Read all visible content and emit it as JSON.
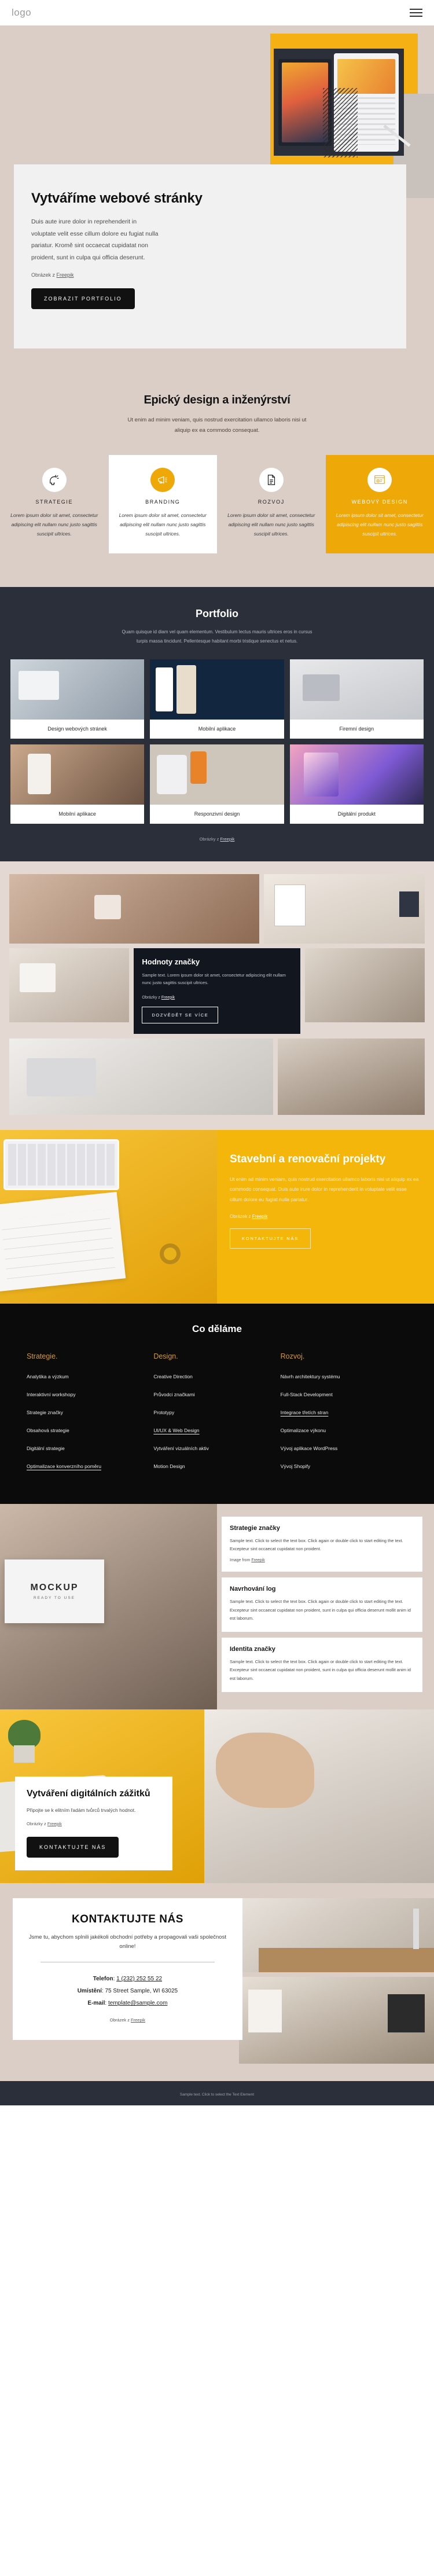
{
  "header": {
    "logo": "logo",
    "menu_icon": "hamburger-icon"
  },
  "hero": {
    "title": "Vytváříme webové stránky",
    "body": "Duis aute irure dolor in reprehenderit in voluptate velit esse cillum dolore eu fugiat nulla pariatur. Kromě sint occaecat cupidatat non proident, sunt in culpa qui officia deserunt.",
    "credit_prefix": "Obrázek z ",
    "credit_link": "Freepik",
    "cta": "ZOBRAZIT PORTFOLIO"
  },
  "services": {
    "title": "Epický design a inženýrství",
    "subtitle": "Ut enim ad minim veniam, quis nostrud exercitation ullamco laboris nisi ut aliquip ex ea commodo consequat.",
    "items": [
      {
        "icon": "head-idea-icon",
        "title": "STRATEGIE",
        "text": "Lorem ipsum dolor sit amet, consectetur adipiscing elit nullam nunc justo sagittis suscipit ultrices.",
        "style": "plain"
      },
      {
        "icon": "megaphone-icon",
        "title": "BRANDING",
        "text": "Lorem ipsum dolor sit amet, consectetur adipiscing elit nullam nunc justo sagittis suscipit ultrices.",
        "style": "white"
      },
      {
        "icon": "document-icon",
        "title": "ROZVOJ",
        "text": "Lorem ipsum dolor sit amet, consectetur adipiscing elit nullam nunc justo sagittis suscipit ultrices.",
        "style": "plain"
      },
      {
        "icon": "browser-design-icon",
        "title": "WEBOVÝ DESIGN",
        "text": "Lorem ipsum dolor sit amet, consectetur adipiscing elit nullam nunc justo sagittis suscipit ultrices.",
        "style": "yellow"
      }
    ]
  },
  "portfolio": {
    "title": "Portfolio",
    "subtitle": "Quam quisque id diam vel quam elementum. Vestibulum lectus mauris ultrices eros in cursus turpis massa tincidunt. Pellentesque habitant morbi tristique senectus et netus.",
    "items": [
      {
        "caption": "Design webových stránek"
      },
      {
        "caption": "Mobilní aplikace"
      },
      {
        "caption": "Firemní design"
      },
      {
        "caption": "Mobilní aplikace"
      },
      {
        "caption": "Responzivní design"
      },
      {
        "caption": "Digitální produkt"
      }
    ],
    "credit_prefix": "Obrázky z ",
    "credit_link": "Freepik"
  },
  "values": {
    "title": "Hodnoty značky",
    "text": "Sample text. Lorem ipsum dolor sit amet, consectetur adipiscing elit nullam nunc justo sagittis suscipit ultrices.",
    "credit_prefix": "Obrázky z ",
    "credit_link": "Freepik",
    "cta": "DOZVĚDĚT SE VÍCE"
  },
  "building": {
    "title": "Stavební a renovační projekty",
    "text": "Ut enim ad minim veniam, quis nostrud exercitation ullamco laboris nisi ut aliquip ex ea commodo consequat. Duis aute irure dolor in reprehenderit in voluptate velit esse cillum dolore eu fugiat nulla pariatur.",
    "credit_prefix": "Obrázek z ",
    "credit_link": "Freepik",
    "cta": "KONTAKTUJTE NÁS"
  },
  "what_we_do": {
    "title": "Co děláme",
    "columns": [
      {
        "heading": "Strategie.",
        "links": [
          {
            "label": "Analytika a výzkum",
            "underlined": false
          },
          {
            "label": "Interaktivní workshopy",
            "underlined": false
          },
          {
            "label": "Strategie značky",
            "underlined": false
          },
          {
            "label": "Obsahová strategie",
            "underlined": false
          },
          {
            "label": "Digitální strategie",
            "underlined": false
          },
          {
            "label": "Optimalizace konverzního poměru",
            "underlined": true
          }
        ]
      },
      {
        "heading": "Design.",
        "links": [
          {
            "label": "Creative Direction",
            "underlined": false
          },
          {
            "label": "Průvodci značkami",
            "underlined": false
          },
          {
            "label": "Prototypy",
            "underlined": false
          },
          {
            "label": "UI/UX & Web Design",
            "underlined": true
          },
          {
            "label": "Vytváření vizuálních aktiv",
            "underlined": false
          },
          {
            "label": "Motion Design",
            "underlined": false
          }
        ]
      },
      {
        "heading": "Rozvoj.",
        "links": [
          {
            "label": "Návrh architektury systému",
            "underlined": false
          },
          {
            "label": "Full-Stack Development",
            "underlined": false
          },
          {
            "label": "Integrace třetích stran",
            "underlined": true
          },
          {
            "label": "Optimalizace výkonu",
            "underlined": false
          },
          {
            "label": "Vývoj aplikace WordPress",
            "underlined": false
          },
          {
            "label": "Vývoj Shopify",
            "underlined": false
          }
        ]
      }
    ]
  },
  "mockup": {
    "label": "MOCKUP",
    "sublabel": "READY TO USE",
    "cards": [
      {
        "title": "Strategie značky",
        "text": "Sample text. Click to select the text box. Click again or double click to start editing the text. Excepteur sint occaecat cupidatat non proident.",
        "credit_prefix": "Image from ",
        "credit_link": "Freepik"
      },
      {
        "title": "Navrhování log",
        "text": "Sample text. Click to select the text box. Click again or double click to start editing the text. Excepteur sint occaecat cupidatat non proident, sunt in culpa qui officia deserunt mollit anim id est laborum.",
        "credit_prefix": "",
        "credit_link": ""
      },
      {
        "title": "Identita značky",
        "text": "Sample text. Click to select the text box. Click again or double click to start editing the text. Excepteur sint occaecat cupidatat non proident, sunt in culpa qui officia deserunt mollit anim id est laborum.",
        "credit_prefix": "",
        "credit_link": ""
      }
    ]
  },
  "digital": {
    "title": "Vytváření digitálních zážitků",
    "text": "Připojte se k elitním řadám tvůrců trvalých hodnot.",
    "credit_prefix": "Obrázky z ",
    "credit_link": "Freepik",
    "cta": "KONTAKTUJTE NÁS"
  },
  "contact": {
    "title": "KONTAKTUJTE NÁS",
    "lead": "Jsme tu, abychom splnili jakékoli obchodní potřeby a propagovali vaši společnost online!",
    "phone_label": "Telefon",
    "phone_value": "1 (232) 252 55 22",
    "location_label": "Umístění",
    "location_value": "75 Street Sample, WI 63025",
    "email_label": "E-mail",
    "email_value": "template@sample.com",
    "credit_prefix": "Obrázek z ",
    "credit_link": "Freepik"
  },
  "footer": {
    "prefix": "Sample text. Click to select the Text Element",
    "link": ""
  },
  "colors": {
    "beige": "#dbcec6",
    "yellow": "#f5b60c",
    "amber": "#eea808",
    "dark": "#2b2f3a",
    "black": "#0b0b0b",
    "gold": "#d29b3c"
  }
}
